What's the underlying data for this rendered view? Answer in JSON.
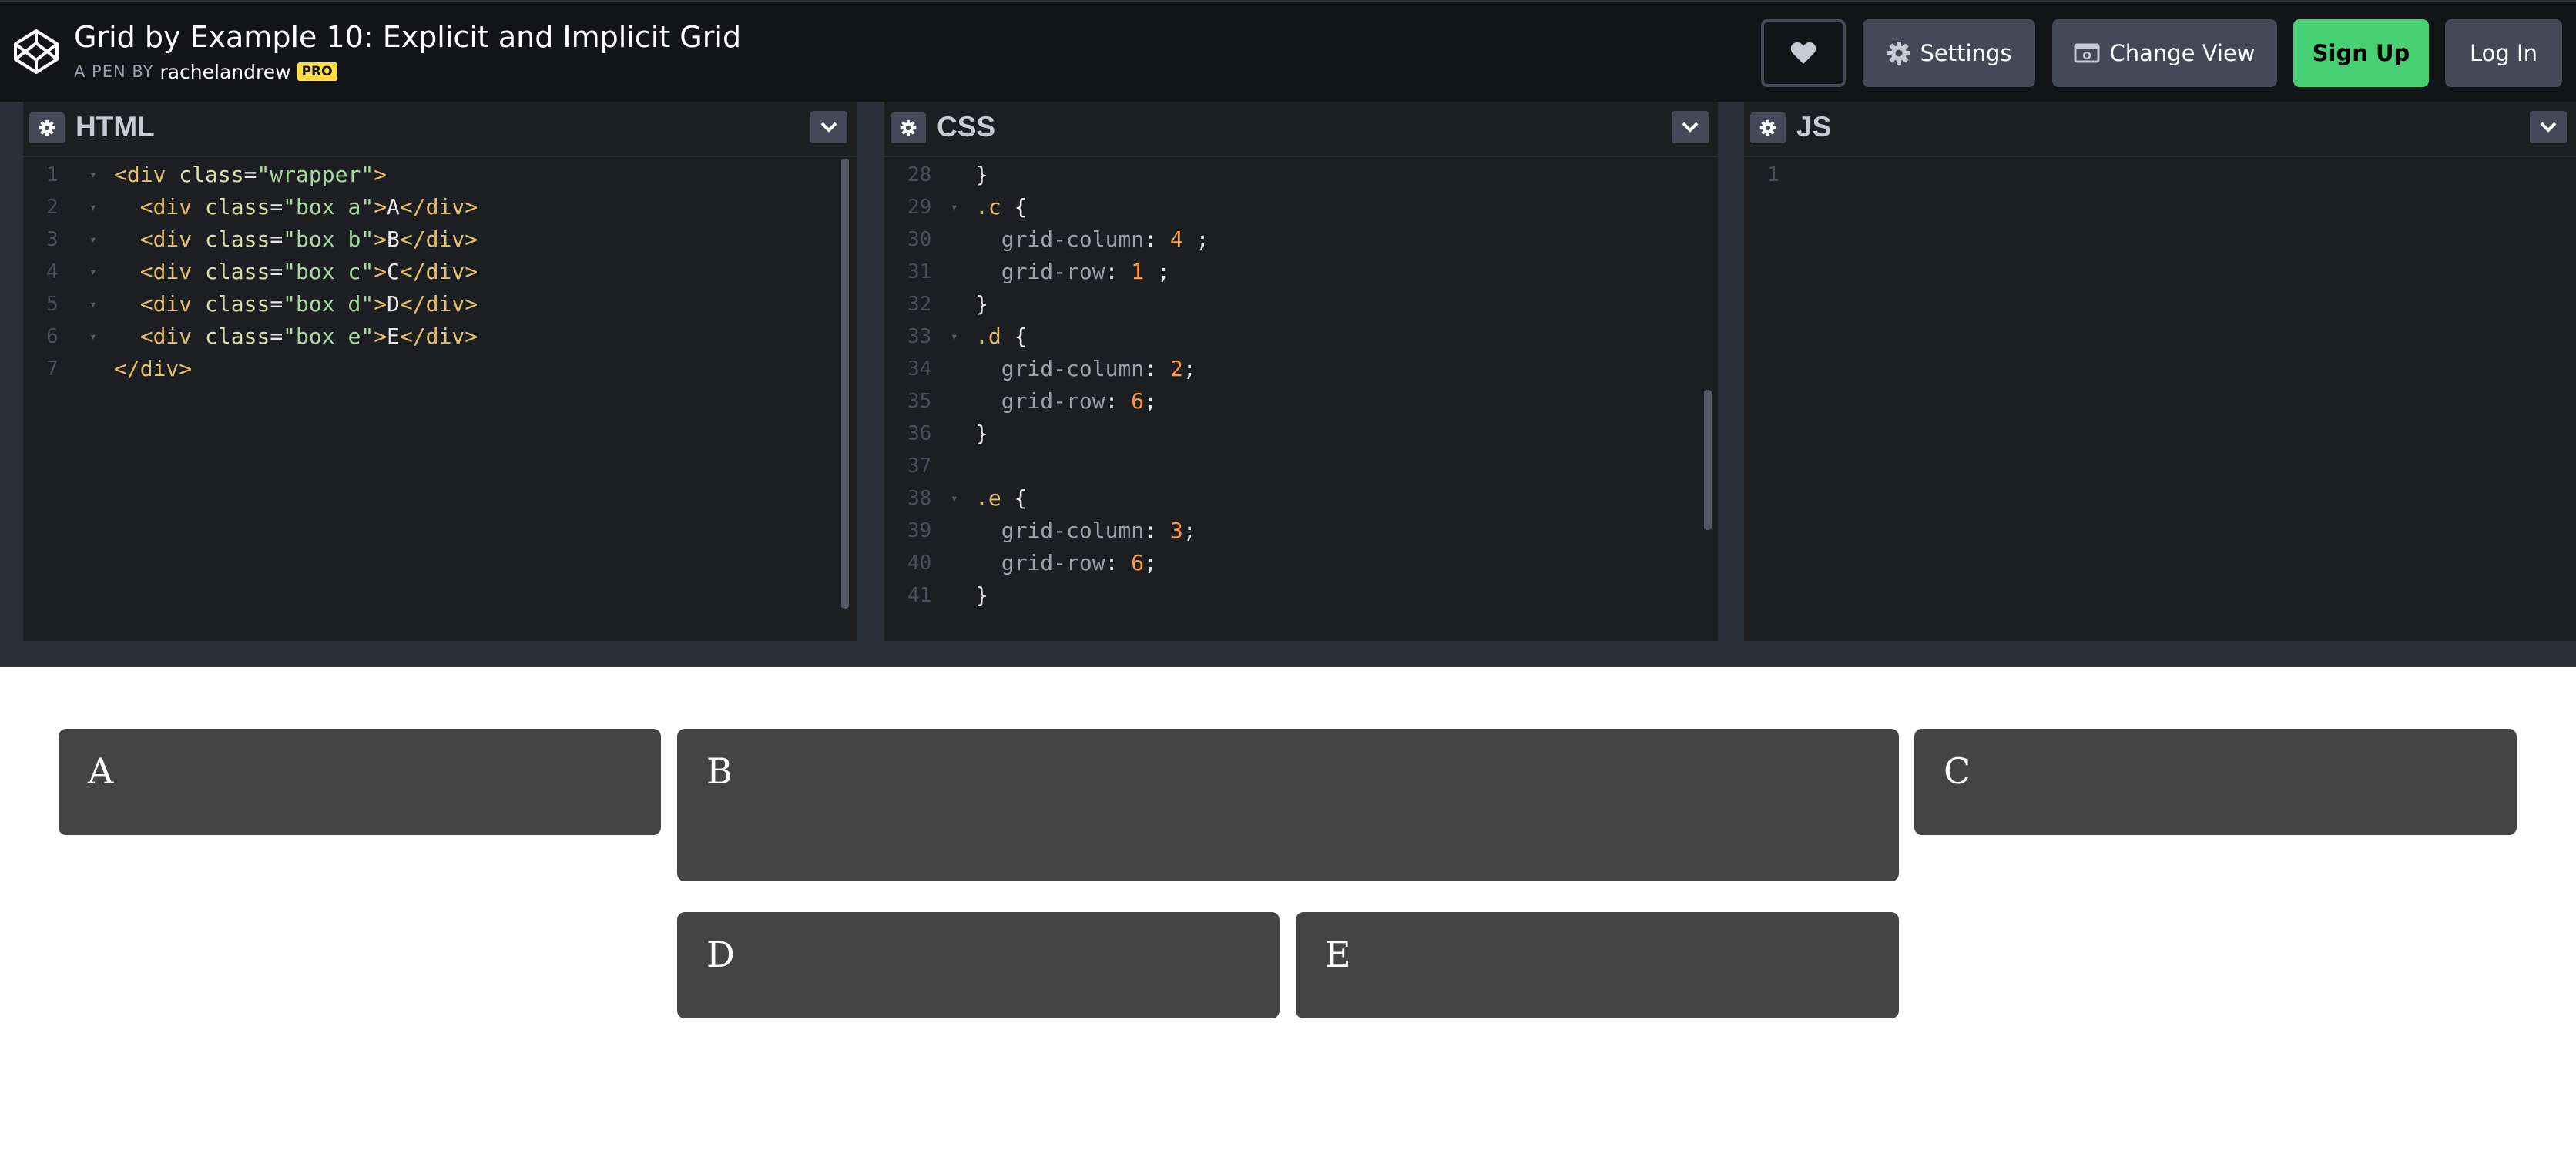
{
  "header": {
    "title": "Grid by Example 10: Explicit and Implicit Grid",
    "pen_by": "A PEN BY",
    "author": "rachelandrew",
    "pro_badge": "PRO",
    "buttons": {
      "settings": "Settings",
      "change_view": "Change View",
      "sign_up": "Sign Up",
      "log_in": "Log In"
    }
  },
  "editors": {
    "html": {
      "title": "HTML",
      "lines": [
        {
          "n": "1",
          "fold": true,
          "parts": [
            [
              "tag",
              "<div "
            ],
            [
              "attr",
              "class"
            ],
            [
              "pun",
              "="
            ],
            [
              "str",
              "\"wrapper\""
            ],
            [
              "tag",
              ">"
            ]
          ]
        },
        {
          "n": "2",
          "fold": true,
          "parts": [
            [
              "pun",
              "  "
            ],
            [
              "tag",
              "<div "
            ],
            [
              "attr",
              "class"
            ],
            [
              "pun",
              "="
            ],
            [
              "str",
              "\"box a\""
            ],
            [
              "tag",
              ">"
            ],
            [
              "txt",
              "A"
            ],
            [
              "tag",
              "</div>"
            ]
          ]
        },
        {
          "n": "3",
          "fold": true,
          "parts": [
            [
              "pun",
              "  "
            ],
            [
              "tag",
              "<div "
            ],
            [
              "attr",
              "class"
            ],
            [
              "pun",
              "="
            ],
            [
              "str",
              "\"box b\""
            ],
            [
              "tag",
              ">"
            ],
            [
              "txt",
              "B"
            ],
            [
              "tag",
              "</div>"
            ]
          ]
        },
        {
          "n": "4",
          "fold": true,
          "parts": [
            [
              "pun",
              "  "
            ],
            [
              "tag",
              "<div "
            ],
            [
              "attr",
              "class"
            ],
            [
              "pun",
              "="
            ],
            [
              "str",
              "\"box c\""
            ],
            [
              "tag",
              ">"
            ],
            [
              "txt",
              "C"
            ],
            [
              "tag",
              "</div>"
            ]
          ]
        },
        {
          "n": "5",
          "fold": true,
          "parts": [
            [
              "pun",
              "  "
            ],
            [
              "tag",
              "<div "
            ],
            [
              "attr",
              "class"
            ],
            [
              "pun",
              "="
            ],
            [
              "str",
              "\"box d\""
            ],
            [
              "tag",
              ">"
            ],
            [
              "txt",
              "D"
            ],
            [
              "tag",
              "</div>"
            ]
          ]
        },
        {
          "n": "6",
          "fold": true,
          "parts": [
            [
              "pun",
              "  "
            ],
            [
              "tag",
              "<div "
            ],
            [
              "attr",
              "class"
            ],
            [
              "pun",
              "="
            ],
            [
              "str",
              "\"box e\""
            ],
            [
              "tag",
              ">"
            ],
            [
              "txt",
              "E"
            ],
            [
              "tag",
              "</div>"
            ]
          ]
        },
        {
          "n": "7",
          "fold": false,
          "parts": [
            [
              "tag",
              "</div>"
            ]
          ]
        }
      ]
    },
    "css": {
      "title": "CSS",
      "lines": [
        {
          "n": "28",
          "fold": false,
          "parts": [
            [
              "pun",
              "}"
            ]
          ]
        },
        {
          "n": "29",
          "fold": true,
          "parts": [
            [
              "sel",
              ".c"
            ],
            [
              "pun",
              " {"
            ]
          ]
        },
        {
          "n": "30",
          "fold": false,
          "parts": [
            [
              "pun",
              "  "
            ],
            [
              "prop",
              "grid-column"
            ],
            [
              "pun",
              ": "
            ],
            [
              "num",
              "4"
            ],
            [
              "pun",
              " ;"
            ]
          ]
        },
        {
          "n": "31",
          "fold": false,
          "parts": [
            [
              "pun",
              "  "
            ],
            [
              "prop",
              "grid-row"
            ],
            [
              "pun",
              ": "
            ],
            [
              "num",
              "1"
            ],
            [
              "pun",
              " ;"
            ]
          ]
        },
        {
          "n": "32",
          "fold": false,
          "parts": [
            [
              "pun",
              "}"
            ]
          ]
        },
        {
          "n": "33",
          "fold": true,
          "parts": [
            [
              "sel",
              ".d"
            ],
            [
              "pun",
              " {"
            ]
          ]
        },
        {
          "n": "34",
          "fold": false,
          "parts": [
            [
              "pun",
              "  "
            ],
            [
              "prop",
              "grid-column"
            ],
            [
              "pun",
              ": "
            ],
            [
              "num",
              "2"
            ],
            [
              "pun",
              ";"
            ]
          ]
        },
        {
          "n": "35",
          "fold": false,
          "parts": [
            [
              "pun",
              "  "
            ],
            [
              "prop",
              "grid-row"
            ],
            [
              "pun",
              ": "
            ],
            [
              "num",
              "6"
            ],
            [
              "pun",
              ";"
            ]
          ]
        },
        {
          "n": "36",
          "fold": false,
          "parts": [
            [
              "pun",
              "}"
            ]
          ]
        },
        {
          "n": "37",
          "fold": false,
          "parts": []
        },
        {
          "n": "38",
          "fold": true,
          "parts": [
            [
              "sel",
              ".e"
            ],
            [
              "pun",
              " {"
            ]
          ]
        },
        {
          "n": "39",
          "fold": false,
          "parts": [
            [
              "pun",
              "  "
            ],
            [
              "prop",
              "grid-column"
            ],
            [
              "pun",
              ": "
            ],
            [
              "num",
              "3"
            ],
            [
              "pun",
              ";"
            ]
          ]
        },
        {
          "n": "40",
          "fold": false,
          "parts": [
            [
              "pun",
              "  "
            ],
            [
              "prop",
              "grid-row"
            ],
            [
              "pun",
              ": "
            ],
            [
              "num",
              "6"
            ],
            [
              "pun",
              ";"
            ]
          ]
        },
        {
          "n": "41",
          "fold": false,
          "parts": [
            [
              "pun",
              "}"
            ]
          ]
        }
      ]
    },
    "js": {
      "title": "JS",
      "lines": [
        {
          "n": "1",
          "fold": false,
          "parts": []
        }
      ]
    }
  },
  "result": {
    "boxes": [
      "A",
      "B",
      "C",
      "D",
      "E"
    ]
  },
  "colors": {
    "header_bg": "#131417",
    "editor_bg": "#1d1e22",
    "signup_green": "#47cf73",
    "pro_yellow": "#ffdd40",
    "box_gray": "#444444"
  },
  "icons": [
    "codepen-logo-icon",
    "heart-icon",
    "gear-icon",
    "change-view-icon",
    "chevron-down-icon"
  ]
}
